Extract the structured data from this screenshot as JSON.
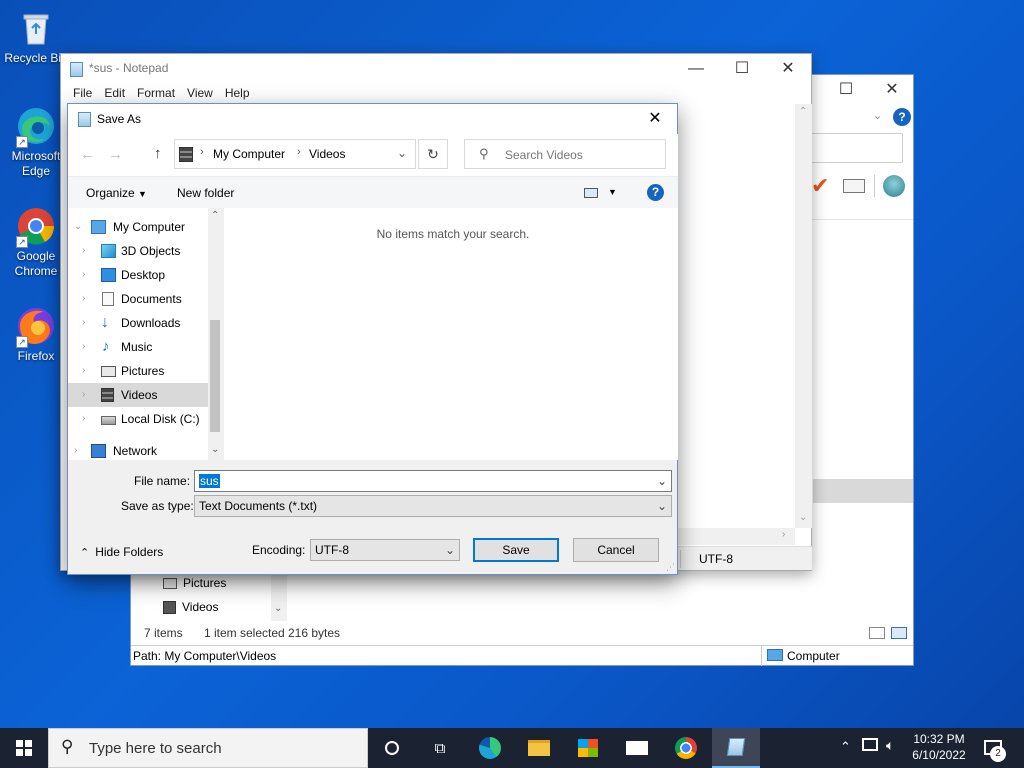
{
  "desktop": {
    "icons": [
      {
        "label": "Recycle Bin",
        "icon": "recycle-bin-icon"
      },
      {
        "label": "Microsoft Edge",
        "icon": "edge-icon"
      },
      {
        "label": "Google Chrome",
        "icon": "chrome-icon"
      },
      {
        "label": "Firefox",
        "icon": "firefox-icon"
      }
    ]
  },
  "explorer": {
    "tree_items": [
      "Pictures",
      "Videos"
    ],
    "status": {
      "items": "7 items",
      "selected": "1 item selected",
      "size": "216 bytes"
    },
    "path_bar": "Path: My Computer\\Videos",
    "location": "Computer"
  },
  "notepad": {
    "title": "*sus - Notepad",
    "menu": [
      "File",
      "Edit",
      "Format",
      "View",
      "Help"
    ],
    "encoding_status": "UTF-8"
  },
  "dialog": {
    "title": "Save As",
    "breadcrumb": [
      "My Computer",
      "Videos"
    ],
    "search_placeholder": "Search Videos",
    "organize_label": "Organize",
    "new_folder_label": "New folder",
    "empty_message": "No items match your search.",
    "tree": [
      {
        "label": "My Computer",
        "icon": "computer-icon"
      },
      {
        "label": "3D Objects",
        "icon": "3d-objects-icon"
      },
      {
        "label": "Desktop",
        "icon": "desktop-icon"
      },
      {
        "label": "Documents",
        "icon": "documents-icon"
      },
      {
        "label": "Downloads",
        "icon": "downloads-icon"
      },
      {
        "label": "Music",
        "icon": "music-icon"
      },
      {
        "label": "Pictures",
        "icon": "pictures-icon"
      },
      {
        "label": "Videos",
        "icon": "videos-icon",
        "selected": true
      },
      {
        "label": "Local Disk (C:)",
        "icon": "local-disk-icon"
      },
      {
        "label": "Network",
        "icon": "network-icon"
      }
    ],
    "file_name_label": "File name:",
    "file_name_value": "sus",
    "save_type_label": "Save as type:",
    "save_type_value": "Text Documents (*.txt)",
    "hide_folders_label": "Hide Folders",
    "encoding_label": "Encoding:",
    "encoding_value": "UTF-8",
    "save_label": "Save",
    "cancel_label": "Cancel"
  },
  "taskbar": {
    "search_placeholder": "Type here to search",
    "time": "10:32 PM",
    "date": "6/10/2022",
    "notification_count": "2"
  },
  "colors": {
    "desktop_blue": "#0b5fd0",
    "accent": "#0078d7",
    "taskbar": "#1b2231",
    "selection": "#cce8ff"
  }
}
